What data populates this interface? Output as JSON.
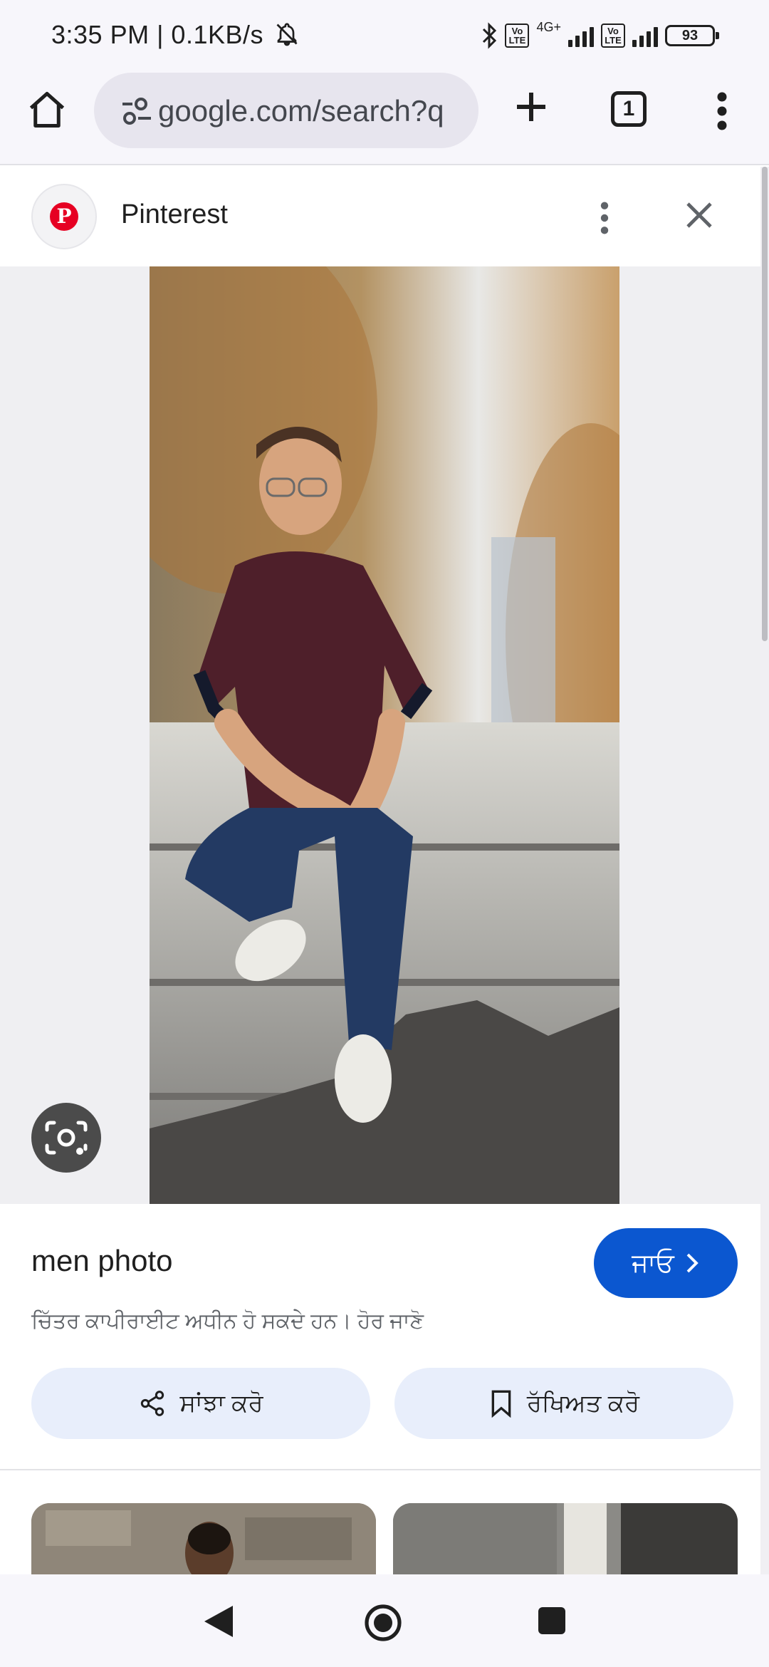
{
  "status_bar": {
    "time_and_speed": "3:35 PM | 0.1KB/s",
    "network_label": "4G+",
    "volte_label": "Vo LTE",
    "battery_level": "93"
  },
  "browser": {
    "url": "google.com/search?q",
    "tab_count": "1"
  },
  "source": {
    "name": "Pinterest",
    "logo_letter": "P",
    "brand_color": "#e60023"
  },
  "info": {
    "query": "men photo",
    "go_label": "ਜਾਓ",
    "copyright_note": "ਚਿੱਤਰ ਕਾਪੀਰਾਈਟ ਅਧੀਨ ਹੋ ਸਕਦੇ ਹਨ। ਹੋਰ ਜਾਣੋ",
    "share_label": "ਸਾਂਝਾ ਕਰੋ",
    "save_label": "ਰੱਖਿਅਤ ਕਰੋ",
    "accent_color": "#0b57d0"
  },
  "icons": {
    "home": "home-icon",
    "tune": "site-settings-icon",
    "plus": "new-tab-icon",
    "menu": "more-vert-icon",
    "close": "close-icon",
    "lens": "google-lens-icon",
    "share": "share-icon",
    "bookmark": "bookmark-icon"
  }
}
